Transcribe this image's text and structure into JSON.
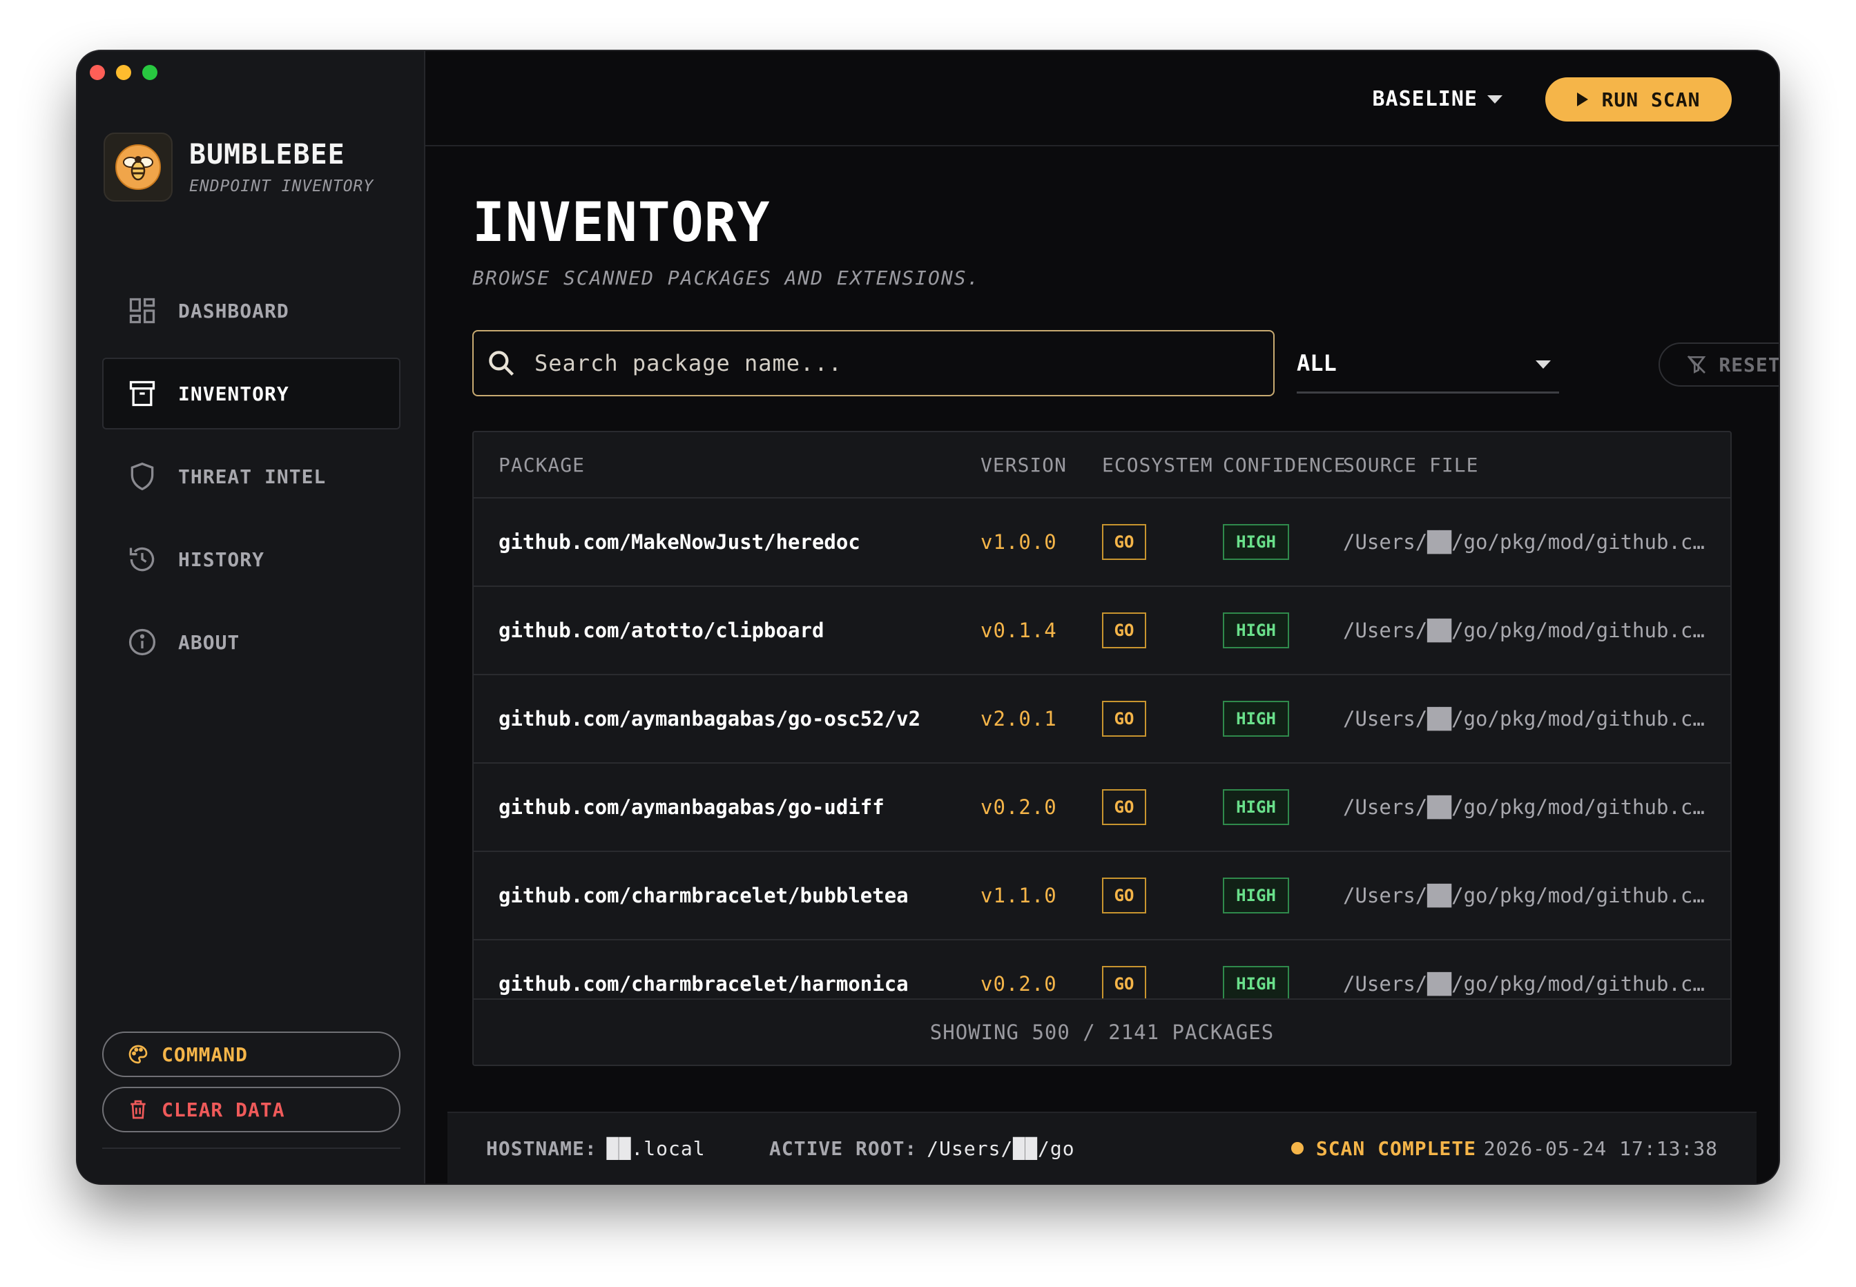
{
  "window": {
    "controls": [
      "close",
      "minimize",
      "zoom"
    ]
  },
  "brand": {
    "name": "BUMBLEBEE",
    "subtitle": "ENDPOINT INVENTORY",
    "logo_icon": "bee-icon"
  },
  "nav": {
    "items": [
      {
        "label": "DASHBOARD",
        "icon": "dashboard-icon",
        "active": false
      },
      {
        "label": "INVENTORY",
        "icon": "archive-icon",
        "active": true
      },
      {
        "label": "THREAT INTEL",
        "icon": "shield-icon",
        "active": false
      },
      {
        "label": "HISTORY",
        "icon": "history-icon",
        "active": false
      },
      {
        "label": "ABOUT",
        "icon": "info-icon",
        "active": false
      }
    ]
  },
  "sidebar_actions": {
    "command_label": "COMMAND",
    "clear_label": "CLEAR DATA"
  },
  "topbar": {
    "baseline_label": "BASELINE",
    "run_scan_label": "RUN SCAN"
  },
  "page": {
    "title": "INVENTORY",
    "subtitle": "BROWSE SCANNED PACKAGES AND EXTENSIONS."
  },
  "search": {
    "placeholder": "Search package name...",
    "value": ""
  },
  "filter": {
    "selected": "ALL"
  },
  "reset_label": "RESET",
  "table": {
    "columns": {
      "package": "PACKAGE",
      "version": "VERSION",
      "ecosystem": "ECOSYSTEM",
      "confidence": "CONFIDENCE",
      "source": "SOURCE FILE"
    },
    "rows": [
      {
        "package": "github.com/MakeNowJust/heredoc",
        "version": "v1.0.0",
        "ecosystem": "GO",
        "confidence": "HIGH",
        "source": "/Users/██/go/pkg/mod/github.c…"
      },
      {
        "package": "github.com/atotto/clipboard",
        "version": "v0.1.4",
        "ecosystem": "GO",
        "confidence": "HIGH",
        "source": "/Users/██/go/pkg/mod/github.c…"
      },
      {
        "package": "github.com/aymanbagabas/go-osc52/v2",
        "version": "v2.0.1",
        "ecosystem": "GO",
        "confidence": "HIGH",
        "source": "/Users/██/go/pkg/mod/github.c…"
      },
      {
        "package": "github.com/aymanbagabas/go-udiff",
        "version": "v0.2.0",
        "ecosystem": "GO",
        "confidence": "HIGH",
        "source": "/Users/██/go/pkg/mod/github.c…"
      },
      {
        "package": "github.com/charmbracelet/bubbletea",
        "version": "v1.1.0",
        "ecosystem": "GO",
        "confidence": "HIGH",
        "source": "/Users/██/go/pkg/mod/github.c…"
      },
      {
        "package": "github.com/charmbracelet/harmonica",
        "version": "v0.2.0",
        "ecosystem": "GO",
        "confidence": "HIGH",
        "source": "/Users/██/go/pkg/mod/github.c…"
      }
    ],
    "footer": "SHOWING 500 / 2141 PACKAGES"
  },
  "statusbar": {
    "hostname_label": "HOSTNAME:",
    "hostname_value": "██.local",
    "root_label": "ACTIVE ROOT:",
    "root_value": "/Users/██/go",
    "status": "SCAN COMPLETE",
    "timestamp": "2026-05-24 17:13:38"
  },
  "colors": {
    "accent": "#f5b549",
    "danger": "#ef5a5a",
    "success": "#6ae08b",
    "background": "#0b0b0d",
    "panel": "#16171a"
  }
}
